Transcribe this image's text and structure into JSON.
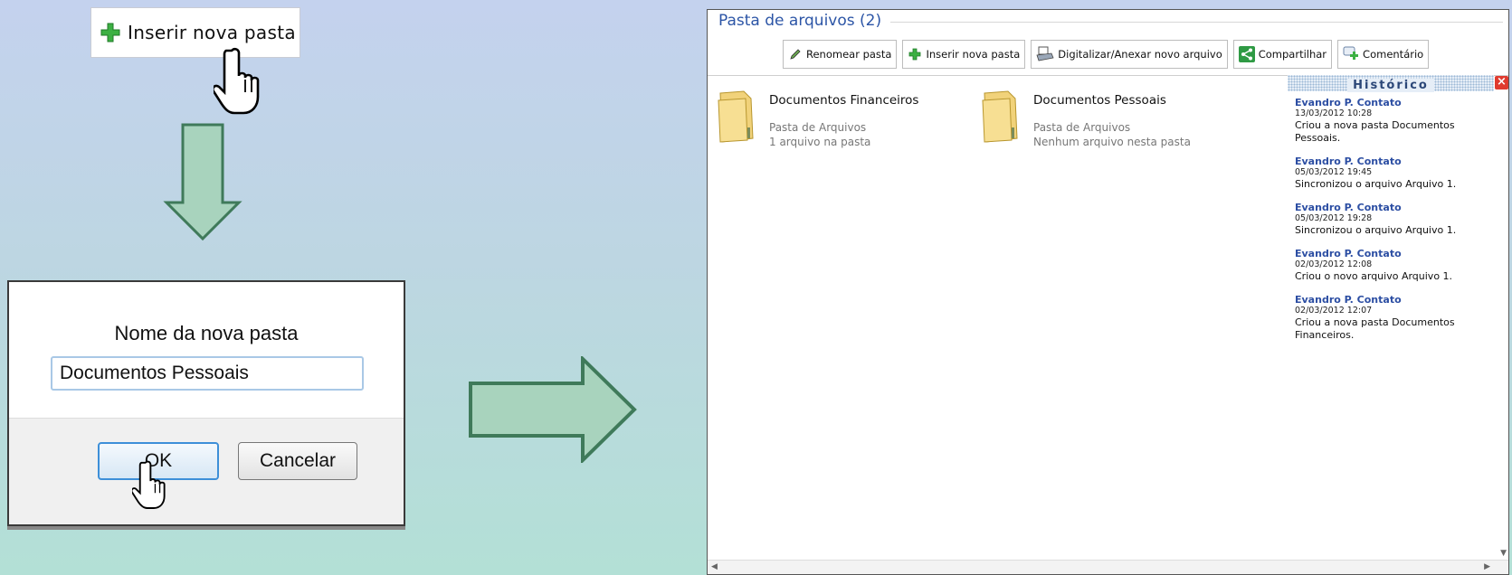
{
  "tutorial": {
    "insert_button_label": "Inserir nova pasta"
  },
  "dialog": {
    "title": "Nome da nova pasta",
    "input_value": "Documentos Pessoais",
    "ok_label": "OK",
    "cancel_label": "Cancelar"
  },
  "panel": {
    "title": "Pasta de arquivos (2)",
    "toolbar": [
      {
        "label": "Renomear pasta",
        "icon": "pencil-icon"
      },
      {
        "label": "Inserir nova pasta",
        "icon": "plus-icon"
      },
      {
        "label": "Digitalizar/Anexar novo arquivo",
        "icon": "scanner-icon"
      },
      {
        "label": "Compartilhar",
        "icon": "share-icon"
      },
      {
        "label": "Comentário",
        "icon": "comment-icon"
      }
    ],
    "folders": [
      {
        "name": "Documentos Financeiros",
        "type": "Pasta de Arquivos",
        "count": "1 arquivo na pasta"
      },
      {
        "name": "Documentos Pessoais",
        "type": "Pasta de Arquivos",
        "count": "Nenhum arquivo nesta pasta"
      }
    ],
    "history": {
      "title": "Histórico",
      "entries": [
        {
          "user": "Evandro P. Contato",
          "date": "13/03/2012 10:28",
          "text": "Criou a nova pasta Documentos Pessoais."
        },
        {
          "user": "Evandro P. Contato",
          "date": "05/03/2012 19:45",
          "text": "Sincronizou o arquivo Arquivo 1."
        },
        {
          "user": "Evandro P. Contato",
          "date": "05/03/2012 19:28",
          "text": "Sincronizou o arquivo Arquivo 1."
        },
        {
          "user": "Evandro P. Contato",
          "date": "02/03/2012 12:08",
          "text": "Criou o novo arquivo Arquivo 1."
        },
        {
          "user": "Evandro P. Contato",
          "date": "02/03/2012 12:07",
          "text": "Criou a nova pasta Documentos Financeiros."
        }
      ]
    }
  },
  "colors": {
    "arrow_fill": "#a8d3bd",
    "arrow_stroke": "#3f7a5a",
    "accent_blue": "#2c55a6"
  }
}
